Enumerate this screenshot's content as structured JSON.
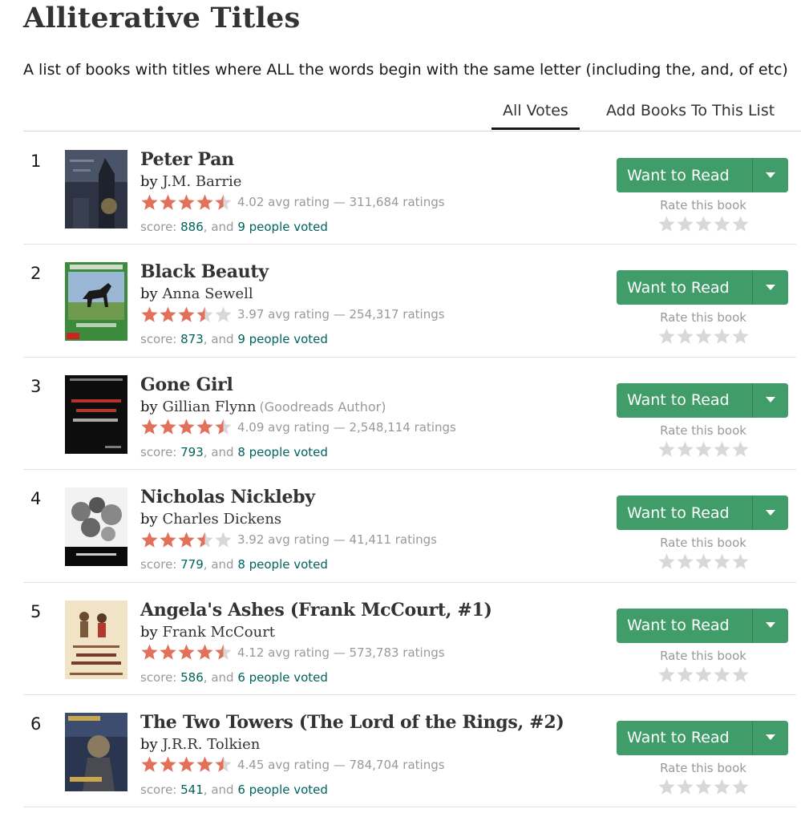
{
  "page": {
    "title": "Alliterative Titles",
    "description": "A list of books with titles where ALL the words begin with the same letter (including the, and, of etc)"
  },
  "tabs": [
    {
      "label": "All Votes",
      "active": true
    },
    {
      "label": "Add Books To This List",
      "active": false
    }
  ],
  "colors": {
    "star_filled": "#e87400",
    "star_rating": "#e1715b",
    "star_empty": "#d8d8d8",
    "want_to_read": "#409d69",
    "link_green": "#00635d"
  },
  "actions": {
    "want_to_read_label": "Want to Read",
    "rate_label": "Rate this book",
    "dropdown_icon": "caret-down-icon"
  },
  "books": [
    {
      "rank": "1",
      "title": "Peter Pan",
      "by": "by",
      "author": "J.M. Barrie",
      "author_badge": "",
      "rating_text": "4.02 avg rating — 311,684 ratings",
      "star_fill": [
        1,
        1,
        1,
        1,
        0.5
      ],
      "score_prefix": "score: ",
      "score": "886",
      "score_sep": ", and ",
      "voted": "9 people voted"
    },
    {
      "rank": "2",
      "title": "Black Beauty",
      "by": "by",
      "author": "Anna Sewell",
      "author_badge": "",
      "rating_text": "3.97 avg rating — 254,317 ratings",
      "star_fill": [
        1,
        1,
        1,
        0.5,
        0
      ],
      "score_prefix": "score: ",
      "score": "873",
      "score_sep": ", and ",
      "voted": "9 people voted"
    },
    {
      "rank": "3",
      "title": "Gone Girl",
      "by": "by",
      "author": "Gillian Flynn",
      "author_badge": "(Goodreads Author)",
      "rating_text": "4.09 avg rating — 2,548,114 ratings",
      "star_fill": [
        1,
        1,
        1,
        1,
        0.5
      ],
      "score_prefix": "score: ",
      "score": "793",
      "score_sep": ", and ",
      "voted": "8 people voted"
    },
    {
      "rank": "4",
      "title": "Nicholas Nickleby",
      "by": "by",
      "author": "Charles Dickens",
      "author_badge": "",
      "rating_text": "3.92 avg rating — 41,411 ratings",
      "star_fill": [
        1,
        1,
        1,
        0.5,
        0
      ],
      "score_prefix": "score: ",
      "score": "779",
      "score_sep": ", and ",
      "voted": "8 people voted"
    },
    {
      "rank": "5",
      "title": "Angela's Ashes (Frank McCourt, #1)",
      "by": "by",
      "author": "Frank McCourt",
      "author_badge": "",
      "rating_text": "4.12 avg rating — 573,783 ratings",
      "star_fill": [
        1,
        1,
        1,
        1,
        0.5
      ],
      "score_prefix": "score: ",
      "score": "586",
      "score_sep": ", and ",
      "voted": "6 people voted"
    },
    {
      "rank": "6",
      "title": "The Two Towers (The Lord of the Rings, #2)",
      "by": "by",
      "author": "J.R.R. Tolkien",
      "author_badge": "",
      "rating_text": "4.45 avg rating — 784,704 ratings",
      "star_fill": [
        1,
        1,
        1,
        1,
        0.5
      ],
      "score_prefix": "score: ",
      "score": "541",
      "score_sep": ", and ",
      "voted": "6 people voted"
    }
  ]
}
